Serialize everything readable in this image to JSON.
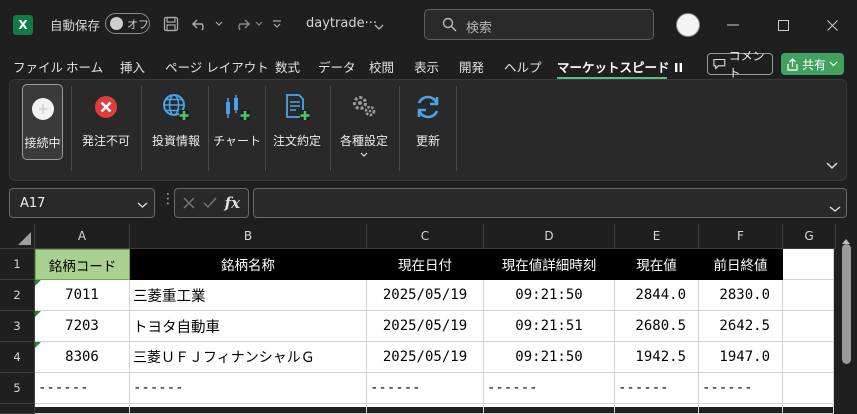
{
  "titlebar": {
    "app_icon": "X",
    "autosave_label": "自動保存",
    "autosave_state": "オフ",
    "filename": "daytrade···",
    "search_placeholder": "検索"
  },
  "menubar": {
    "tabs": [
      "ファイル",
      "ホーム",
      "挿入",
      "ページ レイアウト",
      "数式",
      "データ",
      "校閲",
      "表示",
      "開発",
      "ヘルプ",
      "マーケットスピード II"
    ],
    "active_tab": "マーケットスピード II",
    "comment_label": "コメント",
    "share_label": "共有"
  },
  "ribbon": {
    "buttons": [
      {
        "label": "接続中",
        "icon": "connection-icon",
        "selected": true
      },
      {
        "label": "発注不可",
        "icon": "order-disabled-icon"
      },
      {
        "label": "投資情報",
        "icon": "globe-add-icon"
      },
      {
        "label": "チャート",
        "icon": "chart-add-icon"
      },
      {
        "label": "注文約定",
        "icon": "document-add-icon"
      },
      {
        "label": "各種設定",
        "icon": "gears-icon"
      },
      {
        "label": "更新",
        "icon": "refresh-icon"
      }
    ]
  },
  "formula_bar": {
    "name_box": "A17",
    "formula": ""
  },
  "sheet": {
    "columns": [
      "A",
      "B",
      "C",
      "D",
      "E",
      "F",
      "G"
    ],
    "rows": [
      "1",
      "2",
      "3",
      "4",
      "5"
    ],
    "headers": [
      "銘柄コード",
      "銘柄名称",
      "現在日付",
      "現在値詳細時刻",
      "現在値",
      "前日終値"
    ],
    "data": [
      [
        "7011",
        "三菱重工業",
        "2025/05/19",
        "09:21:50",
        "2844.0",
        "2830.0"
      ],
      [
        "7203",
        "トヨタ自動車",
        "2025/05/19",
        "09:21:51",
        "2680.5",
        "2642.5"
      ],
      [
        "8306",
        "三菱ＵＦＪフィナンシャルＧ",
        "2025/05/19",
        "09:21:50",
        "1942.5",
        "1947.0"
      ],
      [
        "------",
        "------",
        "------",
        "------",
        "------",
        "------"
      ]
    ],
    "accent_colors": {
      "header_a": "#a9d08e",
      "header_bg": "#000000",
      "error_triangle": "#1d8a3b"
    }
  }
}
